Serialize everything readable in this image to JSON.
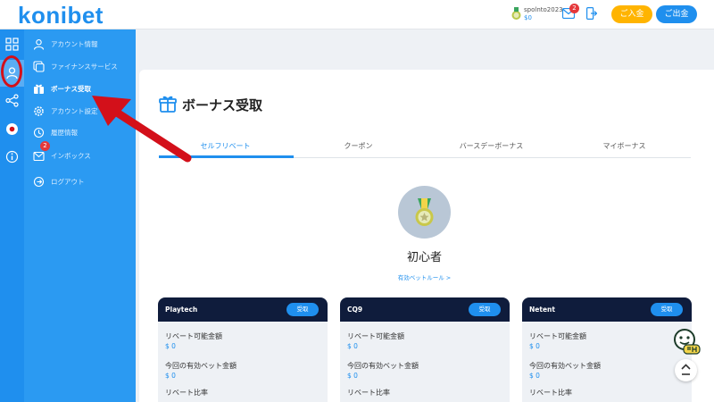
{
  "brand": {
    "logo_text": "konibet"
  },
  "header": {
    "username": "spolnto2023",
    "balance": "$0",
    "mail_badge": "2",
    "deposit_label": "ご入金",
    "withdraw_label": "ご出金"
  },
  "rail_icons": [
    "grid-icon",
    "user-icon",
    "share-icon",
    "japan-flag-icon",
    "info-icon"
  ],
  "menu": {
    "items": [
      {
        "label": "アカウント情報",
        "icon": "user-icon"
      },
      {
        "label": "ファイナンスサービス",
        "icon": "finance-icon"
      },
      {
        "label": "ボーナス受取",
        "icon": "gift-icon"
      },
      {
        "label": "アカウント設定",
        "icon": "gear-icon"
      },
      {
        "label": "履歴情報",
        "icon": "history-icon"
      },
      {
        "label": "インボックス",
        "icon": "inbox-icon"
      },
      {
        "label": "ログアウト",
        "icon": "logout-icon"
      }
    ],
    "inbox_badge": "2"
  },
  "page": {
    "title": "ボーナス受取",
    "tabs": [
      "セルフリベート",
      "クーポン",
      "バースデーボーナス",
      "マイボーナス"
    ],
    "active_tab": 0,
    "level_name": "初心者",
    "rule_link": "有効ベットルール >"
  },
  "providers": [
    {
      "name": "Playtech",
      "button": "受取",
      "rebate_label": "リベート可能金額",
      "rebate_value": "$ 0",
      "bet_label": "今回の有効ベット金額",
      "bet_value": "$ 0",
      "ratio_label": "リベート比率"
    },
    {
      "name": "CQ9",
      "button": "受取",
      "rebate_label": "リベート可能金額",
      "rebate_value": "$ 0",
      "bet_label": "今回の有効ベット金額",
      "bet_value": "$ 0",
      "ratio_label": "リベート比率"
    },
    {
      "name": "Netent",
      "button": "受取",
      "rebate_label": "リベート可能金額",
      "rebate_value": "$ 0",
      "bet_label": "今回の有効ベット金額",
      "bet_value": "$ 0",
      "ratio_label": "リベート比率"
    }
  ],
  "colors": {
    "primary": "#1f8fee",
    "sidebar": "#2b9af2",
    "deposit": "#ffb400",
    "card_head": "#0f1c3c",
    "annotation": "#d3101a"
  }
}
